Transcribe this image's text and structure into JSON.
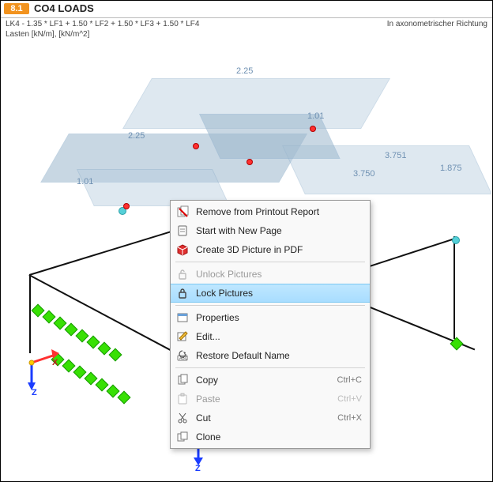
{
  "header": {
    "chip": "8.1",
    "title": "CO4 LOADS"
  },
  "info": {
    "combination": "LK4 - 1.35 * LF1 + 1.50 * LF2 + 1.50 * LF3 + 1.50 * LF4",
    "units": "Lasten [kN/m], [kN/m^2]",
    "projection": "In axonometrischer Richtung"
  },
  "load_values": {
    "v1": "2.25",
    "v2": "1.01",
    "v3": "2.25",
    "v4": "1.01",
    "v5": "3.751",
    "v6": "3.750",
    "v7": "1.875"
  },
  "axes": {
    "x": "X",
    "z": "Z",
    "z2": "Z"
  },
  "context_menu": {
    "remove": "Remove from Printout Report",
    "new_page": "Start with New Page",
    "create_3d": "Create 3D Picture in PDF",
    "unlock": "Unlock Pictures",
    "lock": "Lock Pictures",
    "properties": "Properties",
    "edit": "Edit...",
    "restore": "Restore Default Name",
    "copy": "Copy",
    "copy_sc": "Ctrl+C",
    "paste": "Paste",
    "paste_sc": "Ctrl+V",
    "cut": "Cut",
    "cut_sc": "Ctrl+X",
    "clone": "Clone"
  }
}
